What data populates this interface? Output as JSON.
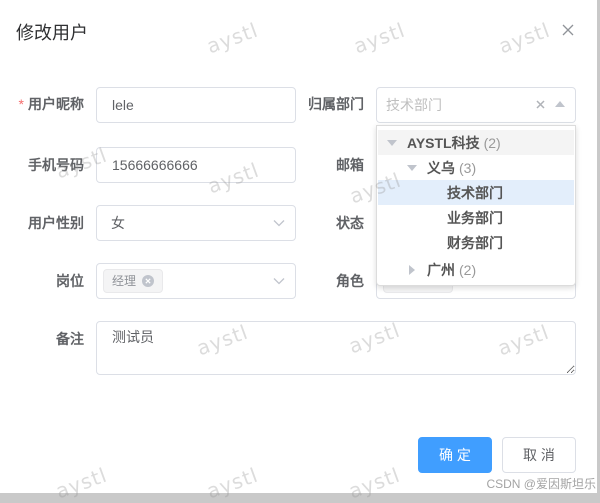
{
  "dialog": {
    "title": "修改用户",
    "close_icon": "close-icon"
  },
  "form": {
    "nickname": {
      "label": "用户昵称",
      "required_mark": "*",
      "value": "lele"
    },
    "department": {
      "label": "归属部门",
      "display_value": "技术部门",
      "clear_icon": "clear-icon",
      "arrow_icon": "caret-up-icon"
    },
    "phone": {
      "label": "手机号码",
      "value": "15666666666"
    },
    "email": {
      "label": "邮箱"
    },
    "gender": {
      "label": "用户性别",
      "value": "女",
      "arrow_icon": "chevron-down-icon"
    },
    "status": {
      "label": "状态"
    },
    "post": {
      "label": "岗位",
      "tags": [
        "经理"
      ],
      "arrow_icon": "chevron-down-icon"
    },
    "role": {
      "label": "角色"
    },
    "remark": {
      "label": "备注",
      "value": "测试员"
    }
  },
  "dept_tree": [
    {
      "label": "AYSTL科技",
      "count": "(2)",
      "expanded": true,
      "children": [
        {
          "label": "义乌",
          "count": "(3)",
          "expanded": true,
          "children": [
            {
              "label": "技术部门",
              "selected": true
            },
            {
              "label": "业务部门"
            },
            {
              "label": "财务部门"
            }
          ]
        },
        {
          "label": "广州",
          "count": "(2)",
          "expanded": false
        }
      ]
    }
  ],
  "footer": {
    "confirm_label": "确 定",
    "cancel_label": "取 消"
  },
  "watermark": {
    "text": "aystl"
  },
  "credit": "CSDN @爱因斯坦乐",
  "colors": {
    "primary": "#409eff",
    "required": "#f56c6c",
    "hover_node_bg": "#f4f4f4",
    "selected_node_bg": "#e3eefb"
  }
}
